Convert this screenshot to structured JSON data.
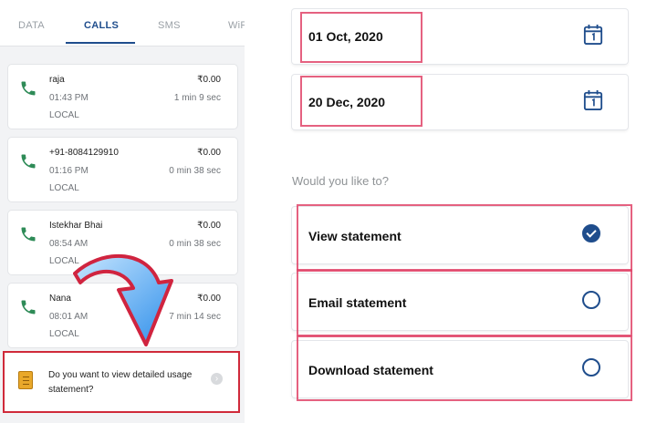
{
  "left": {
    "tabs": [
      {
        "label": "DATA"
      },
      {
        "label": "CALLS"
      },
      {
        "label": "SMS"
      },
      {
        "label": "WiFi"
      }
    ],
    "active_tab": "CALLS",
    "calls": [
      {
        "name": "raja",
        "time": "01:43 PM",
        "type": "LOCAL",
        "amount": "₹0.00",
        "duration": "1 min 9 sec"
      },
      {
        "name": "+91-8084129910",
        "time": "01:16 PM",
        "type": "LOCAL",
        "amount": "₹0.00",
        "duration": "0 min 38 sec"
      },
      {
        "name": "Istekhar Bhai",
        "time": "08:54 AM",
        "type": "LOCAL",
        "amount": "₹0.00",
        "duration": "0 min 38 sec"
      },
      {
        "name": "Nana",
        "time": "08:01 AM",
        "type": "LOCAL",
        "amount": "₹0.00",
        "duration": "7 min 14 sec"
      }
    ],
    "banner": {
      "text": "Do you want to view detailed usage statement?",
      "icon": "book-icon"
    },
    "colors": {
      "accent": "#1f4d8c",
      "highlight": "#d02a3a",
      "phone": "#2e8b57"
    }
  },
  "right": {
    "from_date": "01 Oct, 2020",
    "to_date": "20 Dec, 2020",
    "calendar_icon": "calendar-icon",
    "question": "Would you like to?",
    "options": [
      {
        "label": "View statement",
        "selected": true
      },
      {
        "label": "Email statement",
        "selected": false
      },
      {
        "label": "Download statement",
        "selected": false
      }
    ],
    "colors": {
      "radio": "#1f4d8c",
      "annotation": "#e0456a"
    }
  }
}
